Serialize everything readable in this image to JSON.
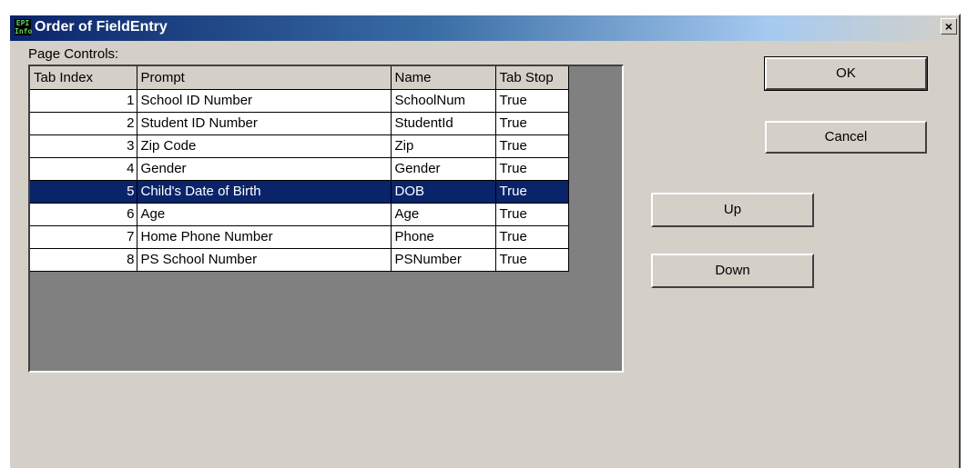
{
  "window": {
    "title": "Order of FieldEntry",
    "icon_text": "EPI Info",
    "close_label": "×"
  },
  "page_controls_label": "Page Controls:",
  "grid": {
    "columns": [
      "Tab Index",
      "Prompt",
      "Name",
      "Tab Stop"
    ],
    "rows": [
      [
        "1",
        "School ID Number",
        "SchoolNum",
        "True"
      ],
      [
        "2",
        "Student ID Number",
        "StudentId",
        "True"
      ],
      [
        "3",
        "Zip Code",
        "Zip",
        "True"
      ],
      [
        "4",
        "Gender",
        "Gender",
        "True"
      ],
      [
        "5",
        "Child's Date of Birth",
        "DOB",
        "True"
      ],
      [
        "6",
        "Age",
        "Age",
        "True"
      ],
      [
        "7",
        "Home Phone Number",
        "Phone",
        "True"
      ],
      [
        "8",
        "PS School Number",
        "PSNumber",
        "True"
      ]
    ],
    "selected_row": 5
  },
  "buttons": {
    "ok": "OK",
    "cancel": "Cancel",
    "up": "Up",
    "down": "Down"
  }
}
